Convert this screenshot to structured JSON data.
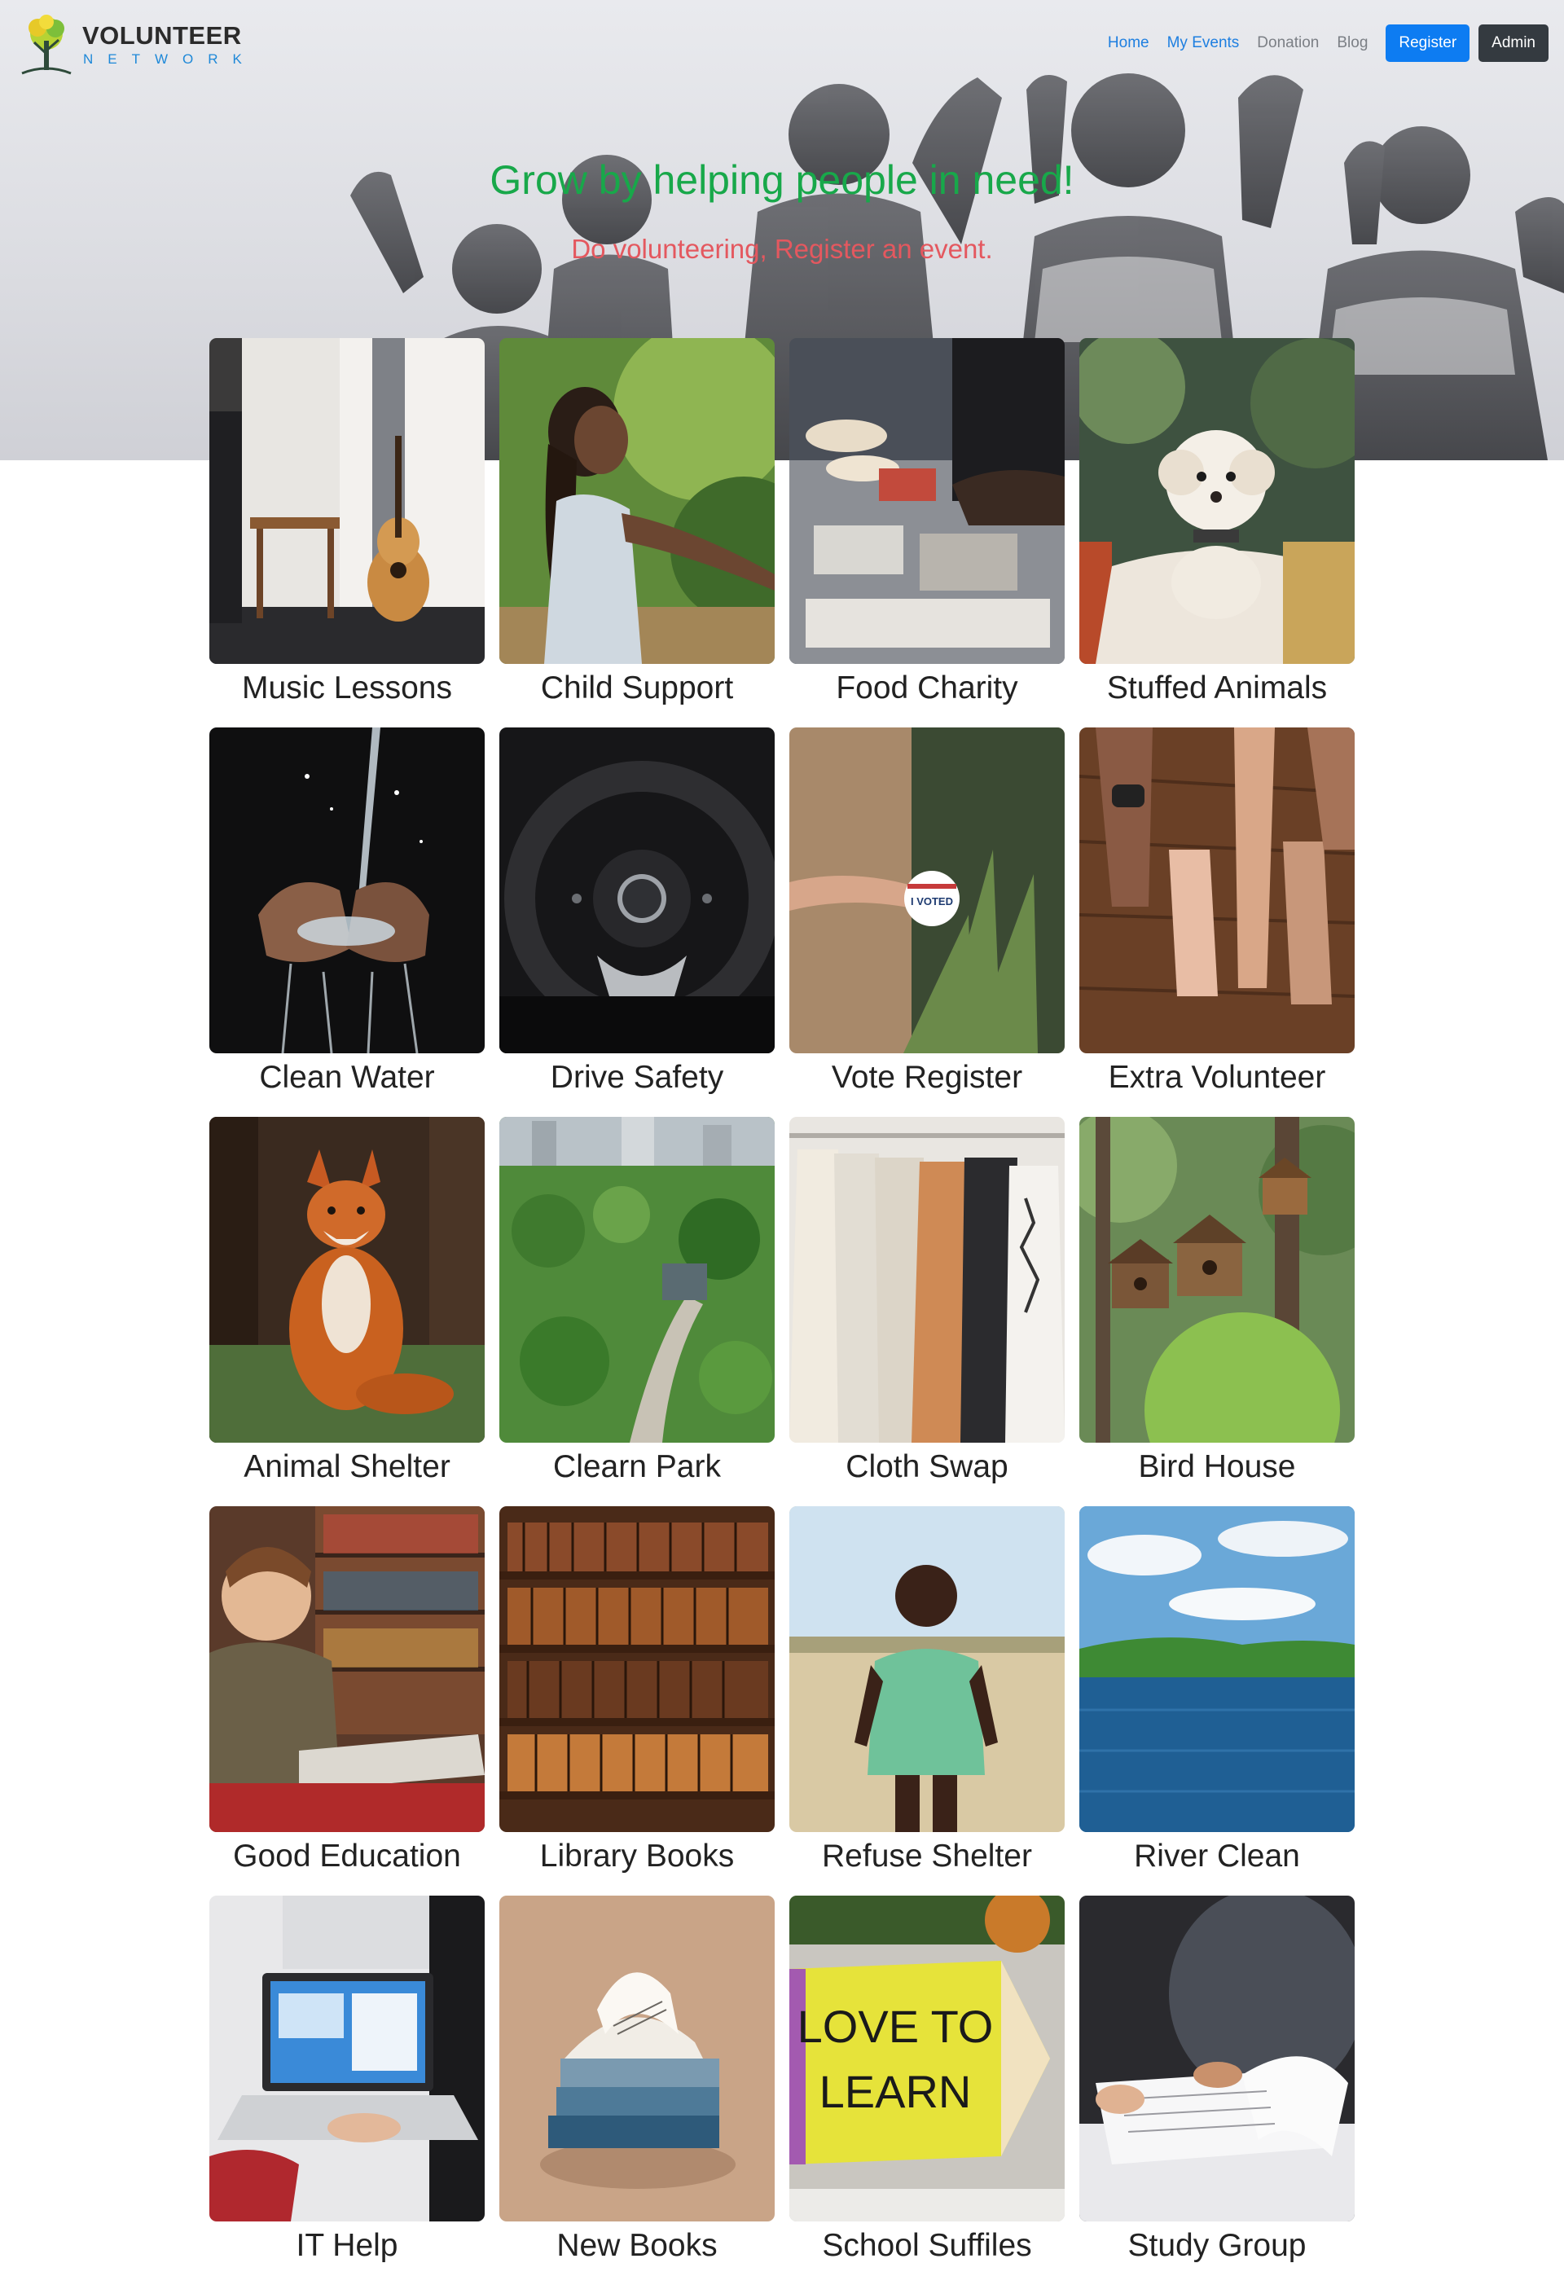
{
  "brand": {
    "name": "VOLUNTEER",
    "tagline": "NETWORK"
  },
  "nav": {
    "links": [
      "Home",
      "My Events",
      "Donation",
      "Blog"
    ],
    "register_label": "Register",
    "admin_label": "Admin"
  },
  "hero": {
    "title": "Grow by helping people in need!",
    "subtitle": "Do volunteering, Register an event."
  },
  "colors": {
    "hero_title": "#18a84a",
    "hero_subtitle": "#e4585f",
    "primary_button": "#0d7cf2",
    "dark_button": "#343a40",
    "link": "#1e7fe0"
  },
  "events": [
    {
      "label": "Music Lessons",
      "image": "guitar-room"
    },
    {
      "label": "Child Support",
      "image": "smiling-girl"
    },
    {
      "label": "Food Charity",
      "image": "food-table"
    },
    {
      "label": "Stuffed Animals",
      "image": "plush-dog"
    },
    {
      "label": "Clean Water",
      "image": "water-hands"
    },
    {
      "label": "Drive Safety",
      "image": "steering-wheel"
    },
    {
      "label": "Vote Register",
      "image": "i-voted-sticker"
    },
    {
      "label": "Extra Volunteer",
      "image": "hands-on-table"
    },
    {
      "label": "Animal Shelter",
      "image": "fox"
    },
    {
      "label": "Clearn Park",
      "image": "city-park"
    },
    {
      "label": "Cloth Swap",
      "image": "clothes-rack"
    },
    {
      "label": "Bird House",
      "image": "birdhouses"
    },
    {
      "label": "Good Education",
      "image": "boy-reading"
    },
    {
      "label": "Library Books",
      "image": "bookshelves"
    },
    {
      "label": "Refuse Shelter",
      "image": "boy-field"
    },
    {
      "label": "River Clean",
      "image": "river"
    },
    {
      "label": "IT Help",
      "image": "laptop"
    },
    {
      "label": "New Books",
      "image": "book-stack"
    },
    {
      "label": "School Suffiles",
      "image": "love-to-learn-pencil"
    },
    {
      "label": "Study Group",
      "image": "study-papers"
    }
  ]
}
